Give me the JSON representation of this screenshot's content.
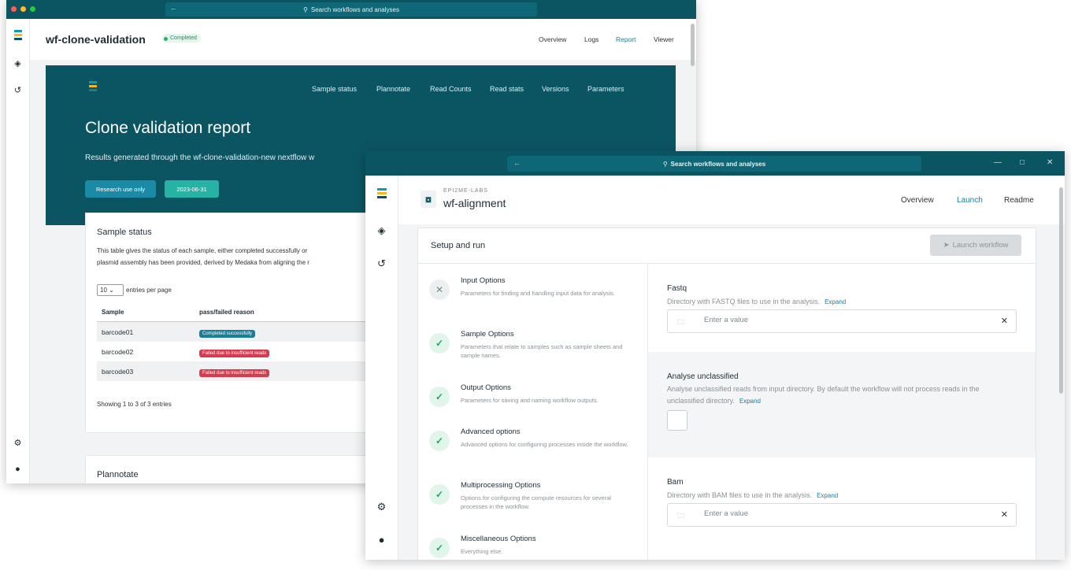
{
  "back_window": {
    "search": "Search workflows and analyses",
    "title": "wf-clone-validation",
    "status": "Completed",
    "nav": [
      "Overview",
      "Logs",
      "Report",
      "Viewer"
    ],
    "report": {
      "nav": [
        "Sample status",
        "Plannotate",
        "Read Counts",
        "Read stats",
        "Versions",
        "Parameters"
      ],
      "title": "Clone validation report",
      "subtitle": "Results generated through the wf-clone-validation-new nextflow w",
      "btn_research": "Research use only",
      "btn_date": "2023-06-31",
      "sample_status": {
        "title": "Sample status",
        "desc1": "This table gives the status of each sample, either completed successfully or",
        "desc2": "plasmid assembly has been provided, derived by Medaka from aligning the r",
        "entries_value": "10",
        "entries_label": "entries per page",
        "columns": [
          "Sample",
          "pass/failed reason"
        ],
        "rows": [
          {
            "sample": "barcode01",
            "reason": "Completed successfully",
            "status": "pass"
          },
          {
            "sample": "barcode02",
            "reason": "Failed due to insufficient reads",
            "status": "fail"
          },
          {
            "sample": "barcode03",
            "reason": "Failed due to insufficient reads",
            "status": "fail"
          }
        ],
        "showing": "Showing 1 to 3 of 3 entries"
      },
      "plannotate_title": "Plannotate"
    }
  },
  "front_window": {
    "search": "Search workflows and analyses",
    "org": "EPI2ME-LABS",
    "title": "wf-alignment",
    "nav": [
      "Overview",
      "Launch",
      "Readme"
    ],
    "setup_title": "Setup and run",
    "launch_label": "Launch workflow",
    "steps": [
      {
        "name": "Input Options",
        "desc": "Parameters for finding and handling input data for analysis.",
        "done": false
      },
      {
        "name": "Sample Options",
        "desc": "Parameters that relate to samples such as sample sheets and sample names.",
        "done": true
      },
      {
        "name": "Output Options",
        "desc": "Parameters for saving and naming workflow outputs.",
        "done": true
      },
      {
        "name": "Advanced options",
        "desc": "Advanced options for configuring processes inside the workflow.",
        "done": true
      },
      {
        "name": "Multiprocessing Options",
        "desc": "Options for configuring the compute resources for several processes in the workflow.",
        "done": true
      },
      {
        "name": "Miscellaneous Options",
        "desc": "Everything else.",
        "done": true
      }
    ],
    "fields": {
      "fastq": {
        "label": "Fastq",
        "desc": "Directory with FASTQ files to use in the analysis.",
        "placeholder": "Enter a value"
      },
      "unclassified": {
        "label": "Analyse unclassified",
        "desc": "Analyse unclassified reads from input directory. By default the workflow will not process reads in the unclassified directory."
      },
      "bam": {
        "label": "Bam",
        "desc": "Directory with BAM files to use in the analysis.",
        "placeholder": "Enter a value"
      }
    },
    "expand_label": "Expand"
  },
  "colors": {
    "brand": "#0b5563",
    "accent": "#1a7f95",
    "success": "#20a566",
    "fail": "#d63c4f",
    "teal": "#26b3a5"
  }
}
